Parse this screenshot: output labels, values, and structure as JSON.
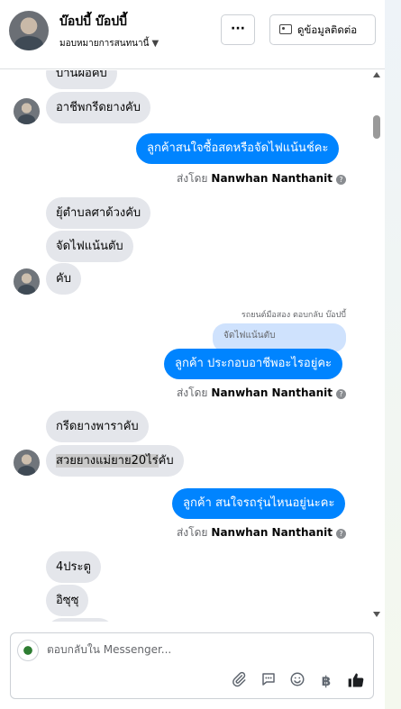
{
  "header": {
    "name": "บ๊อปบี้ บ๊อปบี้",
    "assign_label": "มอบหมายการสนทนานี้",
    "more_label": "···",
    "contact_label": "ดูข้อมูลติดต่อ"
  },
  "messages": {
    "m0": "บ้านผือคับ",
    "m1": "อาชีพกรีดยางคับ",
    "m2": "ลูกค้าสนใจซื้อสดหรือจัดไฟแน้นช์คะ",
    "m3": "ยุ้ตำบลศาด้วงคับ",
    "m4": "จัดไฟแน้นตับ",
    "m5": "คับ",
    "reply_label": "รถยนต์มือสอง ตอบกลับ บ๊อปบี้",
    "reply_quote": "จัดไฟแน้นตับ",
    "m6": "ลูกค้า ประกอบอาชีพอะไรอยู่คะ",
    "m7": "กรีดยางพาราคับ",
    "m8_highlight": "สวยยางแม่ยาย20ไร่",
    "m8_rest": "คับ",
    "m9": "ลูกค้า สนใจรถรุ่นไหนอยู่นะคะ",
    "m10": "4ประตู",
    "m11": "อิซุซุ"
  },
  "sent_by": {
    "prefix": "ส่งโดย",
    "agent": "Nanwhan Nanthanit"
  },
  "composer": {
    "placeholder": "ตอบกลับใน Messenger...",
    "currency_symbol": "฿"
  },
  "colors": {
    "outgoing_bubble": "#0084ff",
    "incoming_bubble": "#e4e6eb"
  }
}
